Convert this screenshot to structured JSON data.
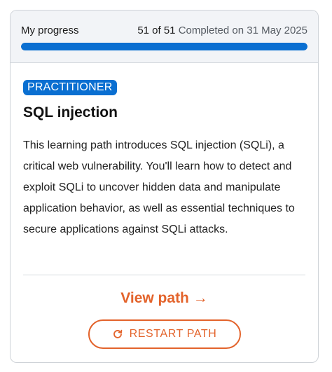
{
  "progress": {
    "label": "My progress",
    "count_text": "51 of 51",
    "completed_text": "Completed on 31 May 2025",
    "completed": 51,
    "total": 51,
    "fraction": 1.0
  },
  "course": {
    "level": "PRACTITIONER",
    "title": "SQL injection",
    "description": "This learning path introduces SQL injection (SQLi), a critical web vulnerability. You'll learn how to detect and exploit SQLi to uncover hidden data and manipulate application behavior, as well as essential techniques to secure applications against SQLi attacks."
  },
  "actions": {
    "view_path_label": "View path →",
    "restart_label": "RESTART PATH",
    "restart_icon": "restart-icon"
  },
  "colors": {
    "accent_blue": "#0a6fd1",
    "accent_orange": "#e3632b"
  }
}
